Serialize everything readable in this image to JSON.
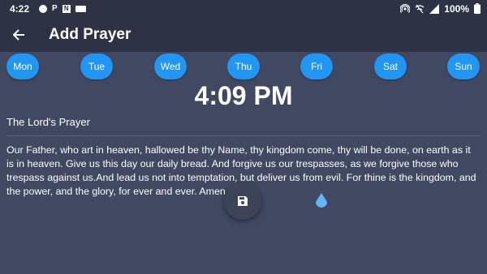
{
  "status_bar": {
    "time": "4:22",
    "notif_p": "P",
    "notif_n": "N",
    "battery": "100%",
    "icons": [
      "circle-icon",
      "p-icon",
      "n-icon",
      "badge-icon",
      "hotspot-icon",
      "wifi-off-icon",
      "signal-icon",
      "battery-icon"
    ]
  },
  "app_bar": {
    "title": "Add Prayer",
    "back_icon": "arrow-left-icon"
  },
  "days": [
    "Mon",
    "Tue",
    "Wed",
    "Thu",
    "Fri",
    "Sat",
    "Sun"
  ],
  "time": "4:09 PM",
  "prayer_title": "The Lord's Prayer",
  "prayer_body": "Our Father, who art in heaven, hallowed be thy Name, thy kingdom come, thy will be done, on earth as it is in heaven. Give us this day our daily bread. And forgive us our trespasses, as we forgive those who trespass against us.And lead us not into temptation, but deliver us from evil. For thine is the kingdom, and the power, and the glory, for ever and ever. Amen.",
  "fab": {
    "icon": "save-icon"
  },
  "colors": {
    "background": "#414861",
    "app_bar": "#2d3244",
    "day_button": "#2196f3",
    "text": "#ffffff"
  }
}
